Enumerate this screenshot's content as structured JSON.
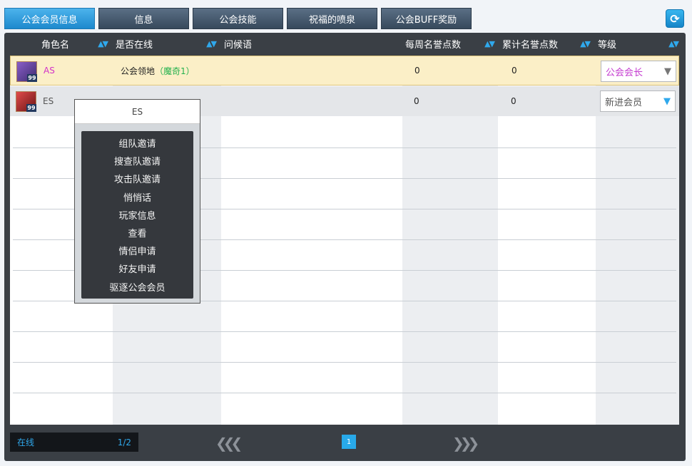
{
  "tabs": [
    "公会会员信息",
    "信息",
    "公会技能",
    "祝福的喷泉",
    "公会BUFF奖励"
  ],
  "refresh_icon": "refresh-icon",
  "headers": {
    "name": "角色名",
    "online": "是否在线",
    "greeting": "问候语",
    "weekly": "每周名誉点数",
    "total": "累计名誉点数",
    "rank": "等级"
  },
  "rows": [
    {
      "name": "AS",
      "level": "99",
      "location": "公会领地",
      "channel": "（魔奇1）",
      "greeting": "",
      "weekly": "0",
      "total": "0",
      "rank": "公会会长"
    },
    {
      "name": "ES",
      "level": "99",
      "location": "",
      "channel": "",
      "greeting": "",
      "weekly": "0",
      "total": "0",
      "rank": "新进会员"
    }
  ],
  "popup": {
    "title": "ES",
    "items": [
      "组队邀请",
      "搜查队邀请",
      "攻击队邀请",
      "悄悄话",
      "玩家信息",
      "查看",
      "情侣申请",
      "好友申请",
      "驱逐公会会员"
    ]
  },
  "footer": {
    "online_label": "在线",
    "online_count": "1/2",
    "current_page": "1"
  },
  "colors": {
    "accent": "#2fa8ec",
    "leader_name": "#d230c8",
    "channel": "#23b14d"
  }
}
